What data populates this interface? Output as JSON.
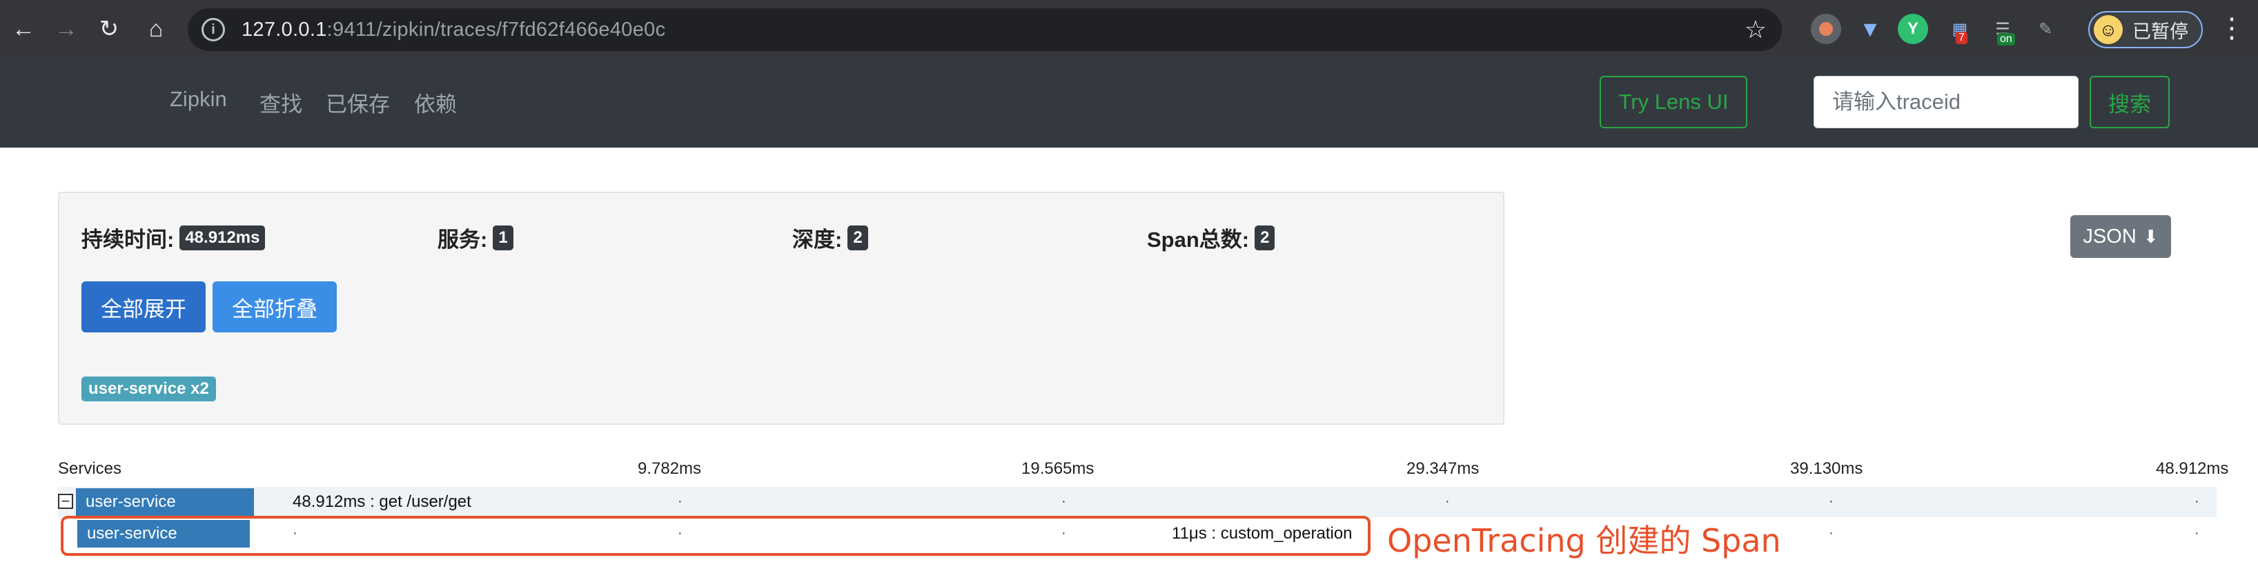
{
  "browser": {
    "url_host": "127.0.0.1",
    "url_rest": ":9411/zipkin/traces/f7fd62f466e40e0c",
    "profile_label": "已暂停",
    "ext_badges": [
      "7",
      "on"
    ]
  },
  "navbar": {
    "brand": "Zipkin",
    "links": [
      "查找",
      "已保存",
      "依赖"
    ],
    "lens_button": "Try Lens UI",
    "trace_placeholder": "请输入traceid",
    "search_button": "搜索"
  },
  "summary": {
    "duration_label": "持续时间:",
    "duration_value": "48.912ms",
    "services_label": "服务:",
    "services_value": "1",
    "depth_label": "深度:",
    "depth_value": "2",
    "span_total_label": "Span总数:",
    "span_total_value": "2",
    "json_button": "JSON",
    "expand_all": "全部展开",
    "collapse_all": "全部折叠",
    "service_badge": "user-service x2"
  },
  "timeline": {
    "services_header": "Services",
    "ticks": [
      "9.782ms",
      "19.565ms",
      "29.347ms",
      "39.130ms",
      "48.912ms"
    ],
    "spans": [
      {
        "service": "user-service",
        "text": "48.912ms : get /user/get",
        "collapsible": true
      },
      {
        "service": "user-service",
        "text": "11μs : custom_operation",
        "collapsible": false
      }
    ]
  },
  "annotation": "OpenTracing 创建的 Span"
}
